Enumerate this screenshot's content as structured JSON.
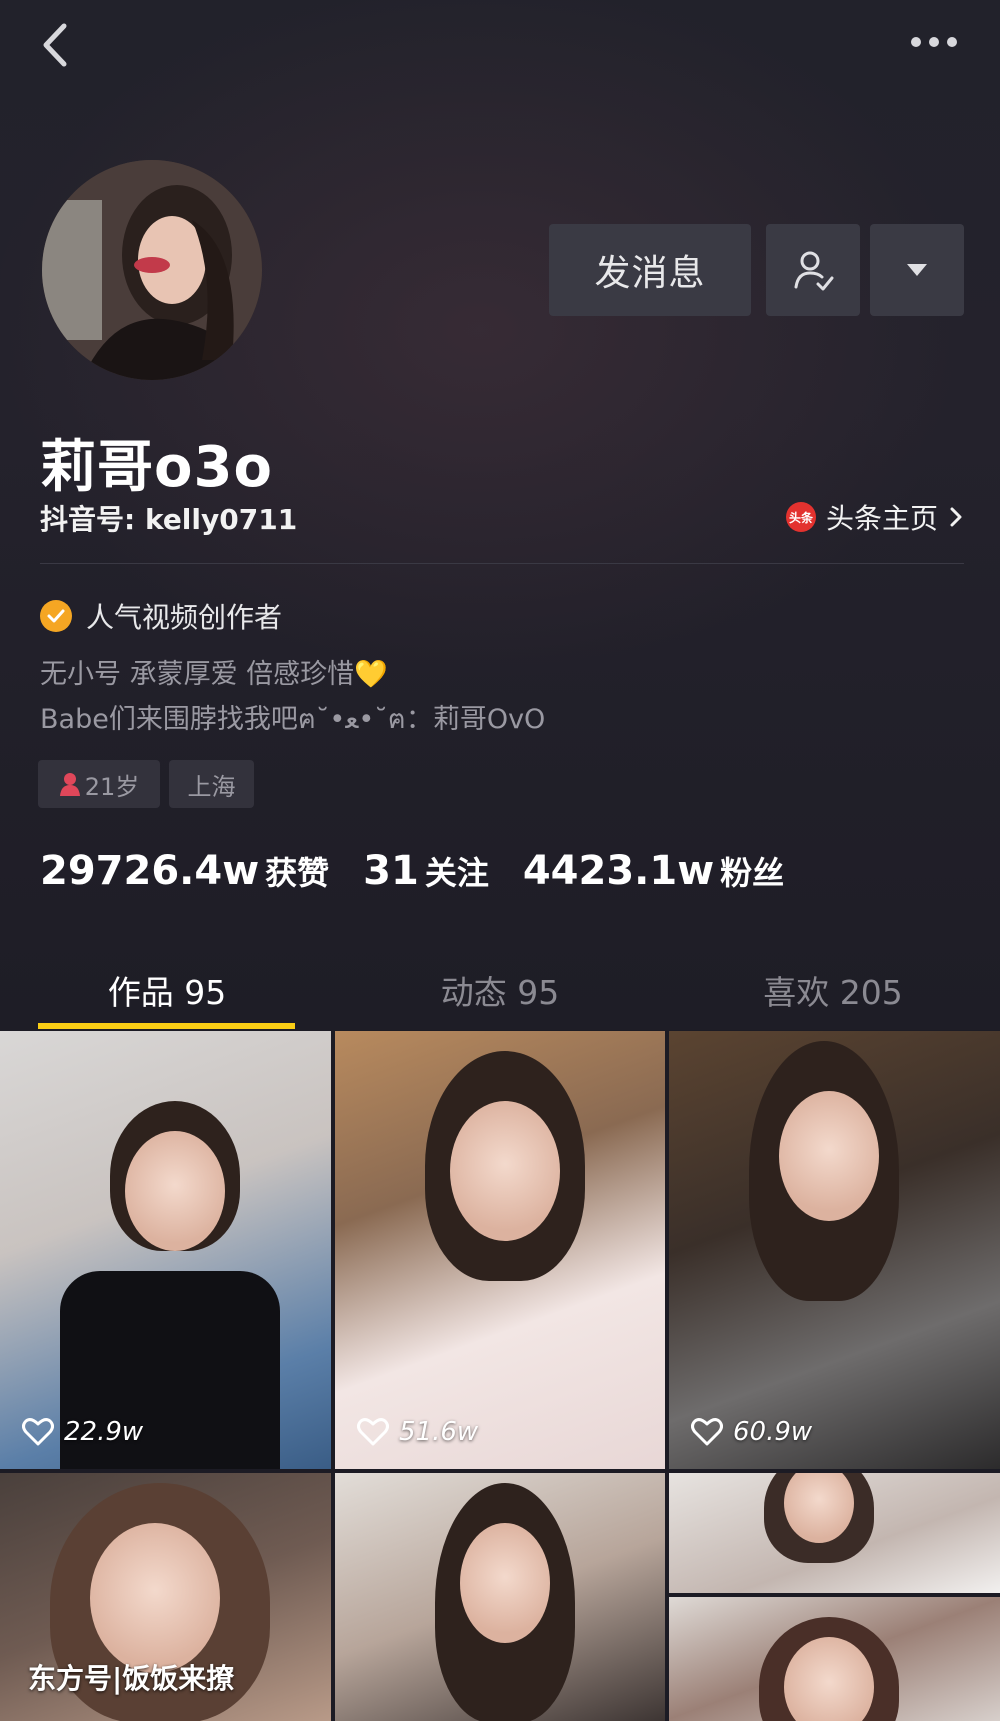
{
  "colors": {
    "background": "#1c1b24",
    "accent_yellow": "#face15",
    "button_bg": "#3a3a44",
    "verify_orange": "#f5a623",
    "toutiao_red": "#e3322f",
    "muted_text": "#9a99a2"
  },
  "nav": {
    "back_icon": "chevron-left-icon",
    "more_icon": "more-horizontal-icon"
  },
  "actions": {
    "message_label": "发消息",
    "follow_icon": "user-check-icon",
    "dropdown_icon": "triangle-down-icon"
  },
  "profile": {
    "username": "莉哥o3o",
    "douyin_id": "抖音号: kelly0711",
    "toutiao_logo_text": "头条",
    "toutiao_label": "头条主页",
    "verify_label": "人气视频创作者",
    "bio_line1": "无小号 承蒙厚爱 倍感珍惜💛",
    "bio_line2": "Babe们来围脖找我吧ฅ˘•ﻌ•˘ฅ：莉哥OvO",
    "age_tag": "21岁",
    "location_tag": "上海"
  },
  "stats": [
    {
      "value": "29726.4w",
      "label": "获赞"
    },
    {
      "value": "31",
      "label": "关注"
    },
    {
      "value": "4423.1w",
      "label": "粉丝"
    }
  ],
  "tabs": [
    {
      "label": "作品 95",
      "active": true
    },
    {
      "label": "动态 95",
      "active": false
    },
    {
      "label": "喜欢 205",
      "active": false
    }
  ],
  "videos": [
    {
      "likes": "22.9w"
    },
    {
      "likes": "51.6w"
    },
    {
      "likes": "60.9w"
    }
  ],
  "watermark": "东方号|饭饭来撩"
}
